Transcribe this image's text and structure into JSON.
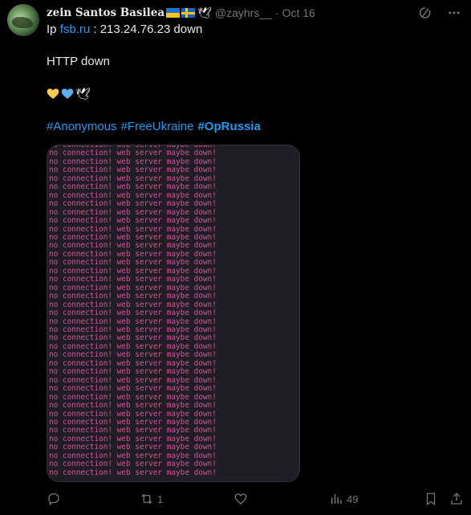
{
  "author": {
    "display_name": "zein Santos Basilea",
    "handle": "@zayhrs__",
    "separator": "·",
    "date": "Oct 16"
  },
  "post": {
    "line1": {
      "prefix": "Ip ",
      "link": "fsb.ru",
      "suffix": " : 213.24.76.23 down"
    },
    "line2": "HTTP down",
    "hashtags": [
      "#Anonymous",
      "#FreeUkraine",
      "#OpRussia"
    ],
    "media": {
      "line_text": "no connection! web server maybe down!",
      "line_count": 40,
      "text_color": "#d0559a",
      "background": "#211d26"
    }
  },
  "icons": {
    "top_right": [
      "grok-icon",
      "more-icon"
    ],
    "actions": [
      "reply-icon",
      "repost-icon",
      "like-icon",
      "views-icon",
      "bookmark-icon",
      "share-icon"
    ]
  },
  "actions": {
    "reply_count": "",
    "repost_count": "1",
    "like_count": "",
    "views_count": "49"
  },
  "colors": {
    "background": "#000000",
    "text": "#e7e9ea",
    "muted": "#71767b",
    "link": "#1d9bf0"
  }
}
